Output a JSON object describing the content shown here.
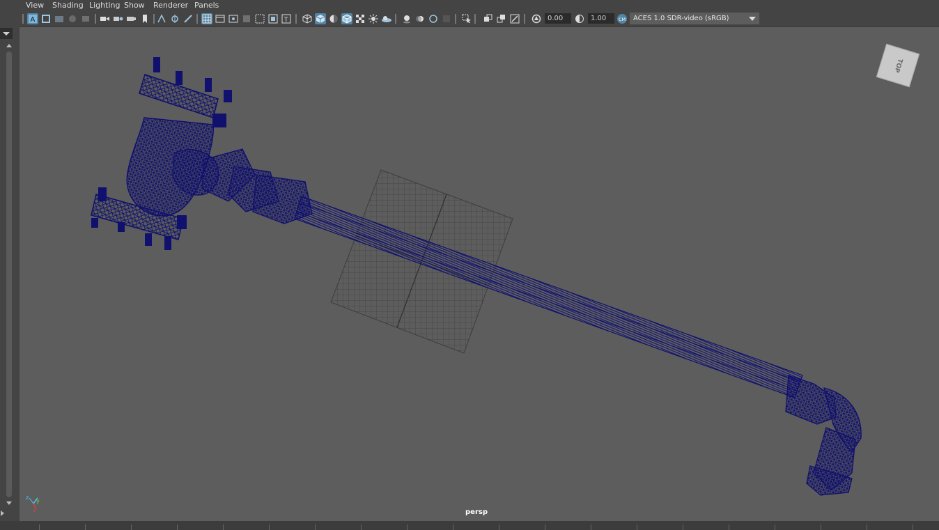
{
  "menu": {
    "items": [
      "View",
      "Shading",
      "Lighting",
      "Show",
      "Renderer",
      "Panels"
    ]
  },
  "toolbar": {
    "icons": [
      "select-camera-icon",
      "camera-attributes-icon",
      "bookmarks-icon",
      "image-plane-icon",
      "2d-pan-zoom-icon",
      "grease-pencil-icon",
      "grid-icon",
      "film-gate-icon",
      "resolution-gate-icon",
      "gate-mask-icon",
      "field-chart-icon",
      "safe-action-icon",
      "safe-title-icon",
      "wireframe-icon",
      "smooth-shade-all-icon",
      "default-material-icon",
      "wireframe-on-shaded-icon",
      "textured-icon",
      "use-all-lights-icon",
      "shadows-icon",
      "screen-space-ao-icon",
      "motion-blur-icon",
      "multisample-aa-icon",
      "depth-of-field-icon",
      "isolate-select-icon",
      "xray-icon",
      "xray-active-components-icon",
      "xray-joints-icon",
      "exposure-icon",
      "gamma-icon",
      "color-management-icon"
    ],
    "exposure_value": "0.00",
    "gamma_value": "1.00",
    "color_space": "ACES 1.0 SDR-video (sRGB)"
  },
  "viewport": {
    "camera_label": "persp",
    "viewcube_label": "TOP",
    "background_color": "#5d5d5d",
    "wireframe_color": "#10106e",
    "grid_color": "#3e3e3e"
  }
}
